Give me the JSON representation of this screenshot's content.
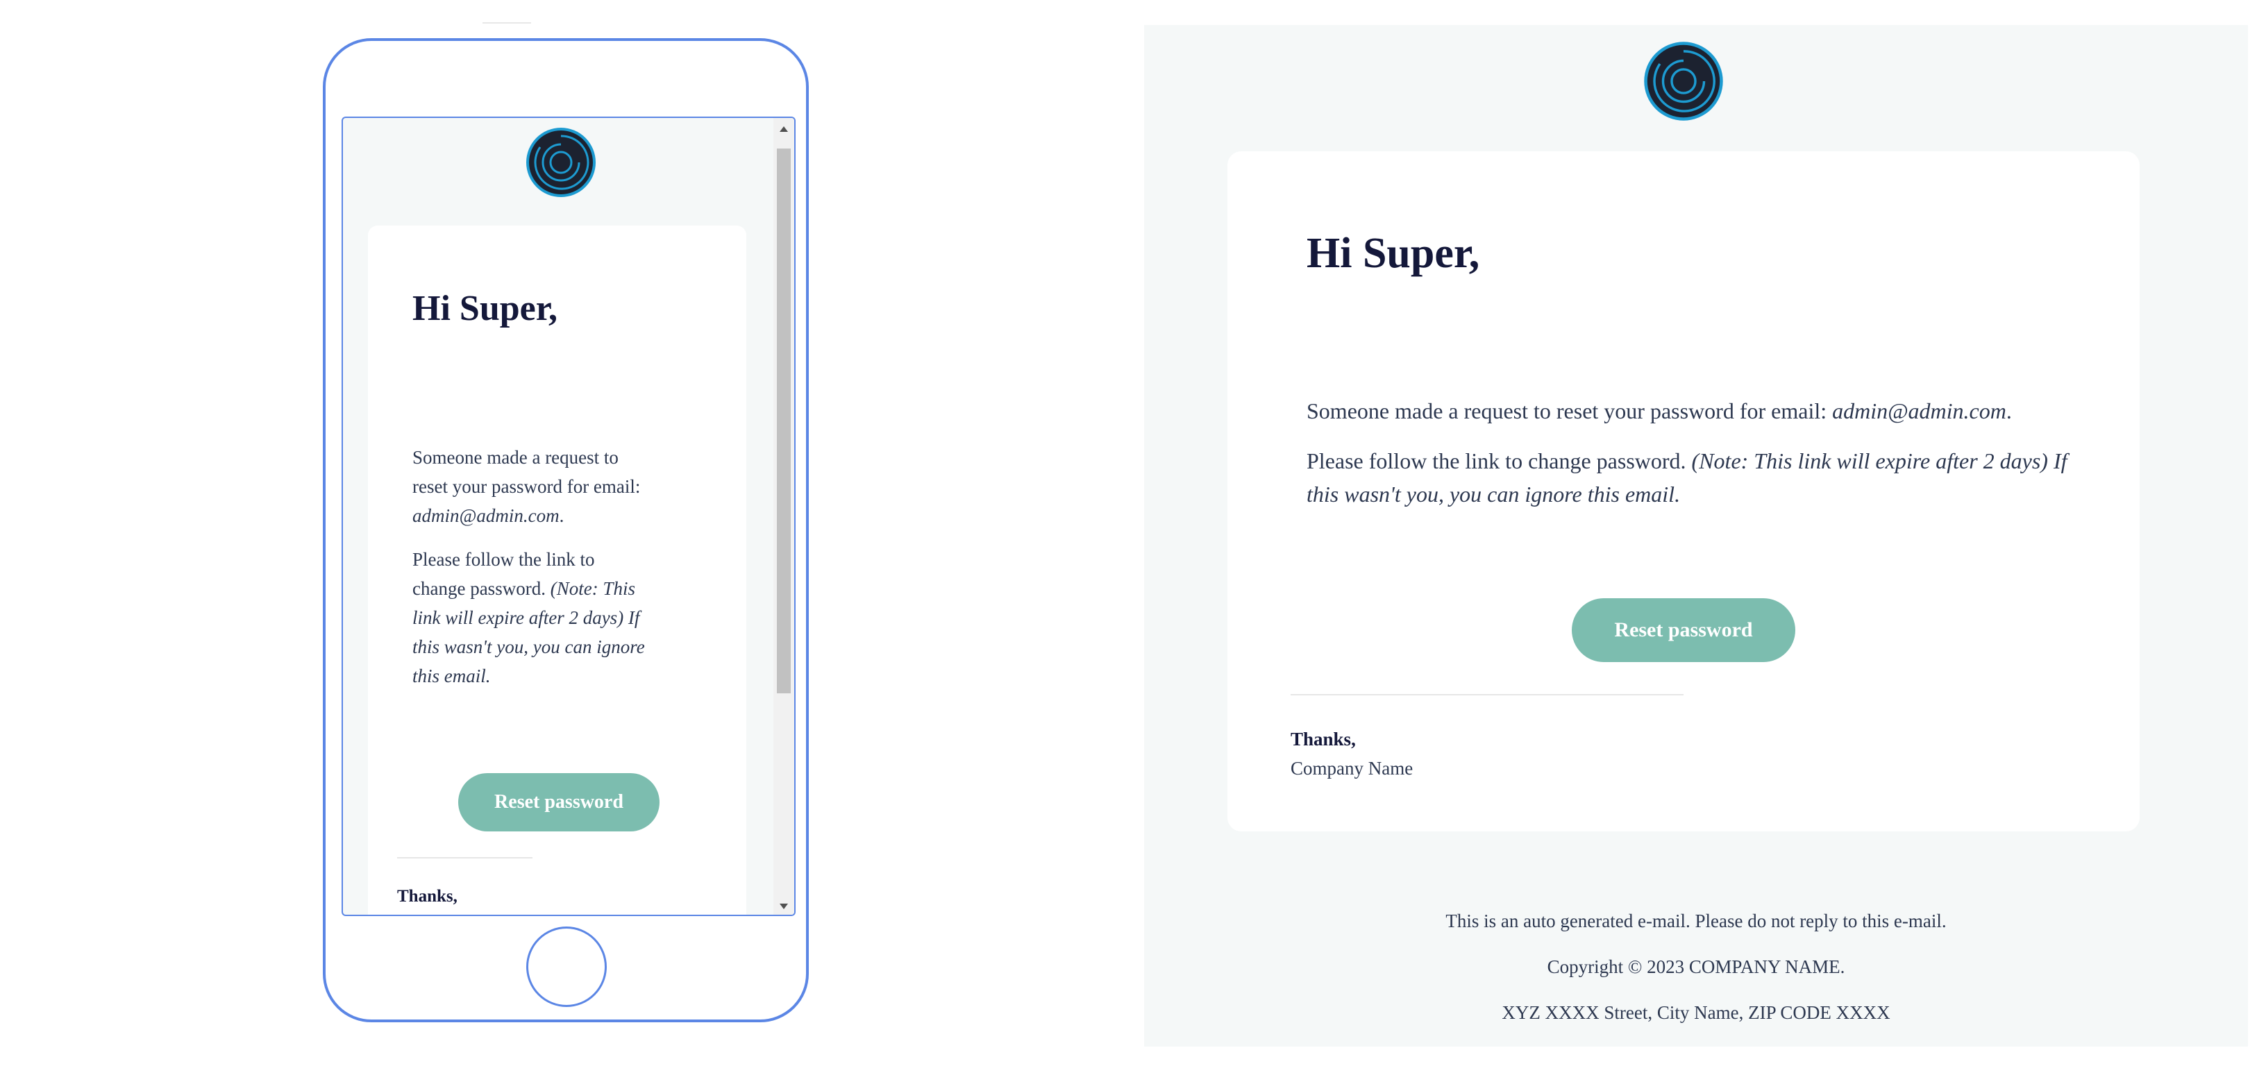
{
  "colors": {
    "frame": "#5b86e5",
    "email_bg": "#f5f8f8",
    "card_bg": "#ffffff",
    "button": "#7cbdaf",
    "heading": "#14183a",
    "body_text": "#2d3850"
  },
  "icons": {
    "logo": "concentric-circle-logo-icon"
  },
  "email": {
    "greeting": "Hi Super,",
    "line1_text": "Someone made a request to reset your password for email: ",
    "line1_email": "admin@admin.com",
    "line1_end": ".",
    "line2_text": "Please follow the link to change password. ",
    "line2_note": "(Note: This link will expire after 2 days) If this wasn't you, you can ignore this email.",
    "button_label": "Reset password",
    "thanks": "Thanks,",
    "company": "Company Name"
  },
  "footer": {
    "auto_note": "This is an auto generated e-mail. Please do not reply to this e-mail.",
    "copyright": "Copyright © 2023 COMPANY NAME.",
    "address": "XYZ XXXX Street, City Name, ZIP CODE XXXX"
  }
}
